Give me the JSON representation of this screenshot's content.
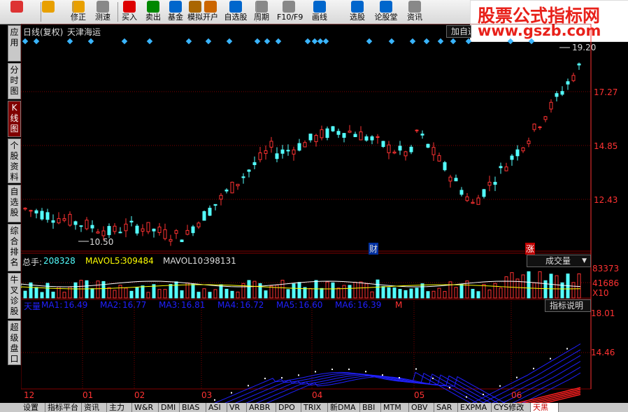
{
  "toolbar": {
    "buttons": [
      {
        "label": "",
        "icon": "color-grid-icon"
      },
      {
        "label": "",
        "icon": "back-arrow-icon"
      },
      {
        "label": "修正",
        "icon": "down-arrow-icon"
      },
      {
        "label": "测速",
        "icon": "clock-icon"
      },
      {
        "label": "买入",
        "icon": "buy-icon"
      },
      {
        "label": "卖出",
        "icon": "sell-icon"
      },
      {
        "label": "基金",
        "icon": "fund-icon"
      },
      {
        "label": "模拟",
        "icon": "hammer-icon"
      },
      {
        "label": "开户",
        "icon": "open-account-icon"
      },
      {
        "label": "自选股",
        "icon": "star-icon"
      },
      {
        "label": "周期",
        "icon": "clock-icon"
      },
      {
        "label": "F10/F9",
        "icon": "f10-icon"
      },
      {
        "label": "画线",
        "icon": "draw-line-icon"
      },
      {
        "label": "选股",
        "icon": "select-stock-icon"
      },
      {
        "label": "论股堂",
        "icon": "forum-icon"
      },
      {
        "label": "资讯",
        "icon": "news-icon"
      }
    ]
  },
  "watermark": {
    "line1": "股票公式指标网",
    "line2": "www.gszb.com"
  },
  "sidetabs": [
    {
      "label": "应用",
      "active": false
    },
    {
      "label": "分时图",
      "active": false
    },
    {
      "label": "K线图",
      "active": true
    },
    {
      "label": "个股资料",
      "active": false
    },
    {
      "label": "自选股",
      "active": false
    },
    {
      "label": "综合排名",
      "active": false
    },
    {
      "label": "牛叉诊股",
      "active": false
    },
    {
      "label": "超级盘口",
      "active": false
    }
  ],
  "kline": {
    "period_label": "日线(复权)",
    "stock_name": "天津海运",
    "add_button": "加自选",
    "price_ticks": [
      "17.27",
      "14.85",
      "12.43"
    ],
    "high_label": "19.20",
    "low_label": "10.50",
    "marker_cai": "财",
    "marker_zhang": "涨"
  },
  "volume": {
    "total_label": "总手:",
    "total_value": "208328",
    "mavol5_label": "MAVOL5:",
    "mavol5_value": "309484",
    "mavol10_label": "MAVOL10:",
    "mavol10_value": "398131",
    "dropdown_label": "成交量",
    "ticks": [
      "83373",
      "41686",
      "X10"
    ]
  },
  "indicator": {
    "name": "天量",
    "ma_items": [
      {
        "label": "MA1:",
        "value": "16.49"
      },
      {
        "label": "MA2:",
        "value": "16.77"
      },
      {
        "label": "MA3:",
        "value": "16.81"
      },
      {
        "label": "MA4:",
        "value": "16.72"
      },
      {
        "label": "MA5:",
        "value": "16.60"
      },
      {
        "label": "MA6:",
        "value": "16.39"
      }
    ],
    "m_label": "M",
    "help_button": "指标说明",
    "ticks": [
      "18.01",
      "14.46"
    ]
  },
  "x_axis_months": [
    "12",
    "01",
    "02",
    "03",
    "04",
    "05",
    "06"
  ],
  "bottom_tabs": [
    {
      "label": "设置",
      "selected": false
    },
    {
      "label": "指标平台",
      "selected": false
    },
    {
      "label": "资讯",
      "selected": false
    },
    {
      "label": "主力",
      "selected": false
    },
    {
      "label": "W&R",
      "selected": false
    },
    {
      "label": "DMI",
      "selected": false
    },
    {
      "label": "BIAS",
      "selected": false
    },
    {
      "label": "ASI",
      "selected": false
    },
    {
      "label": "VR",
      "selected": false
    },
    {
      "label": "ARBR",
      "selected": false
    },
    {
      "label": "DPO",
      "selected": false
    },
    {
      "label": "TRIX",
      "selected": false
    },
    {
      "label": "新DMA",
      "selected": false
    },
    {
      "label": "BBI",
      "selected": false
    },
    {
      "label": "MTM",
      "selected": false
    },
    {
      "label": "OBV",
      "selected": false
    },
    {
      "label": "SAR",
      "selected": false
    },
    {
      "label": "EXPMA",
      "selected": false
    },
    {
      "label": "CYS修改",
      "selected": false
    },
    {
      "label": "天黑",
      "selected": true
    }
  ],
  "colors": {
    "up": "#ff3232",
    "down": "#54ffff",
    "grid": "#800000",
    "accent_yellow": "#ffff00",
    "ma_blue": "#2020ff"
  }
}
